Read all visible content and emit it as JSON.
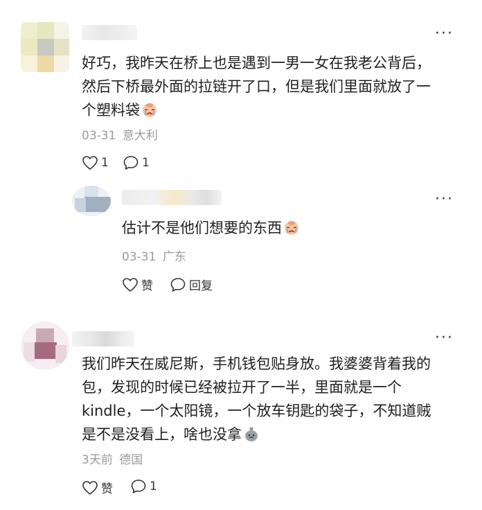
{
  "comments": [
    {
      "text_lines": [
        "好巧，我昨天在桥上也是遇到一男一女在我老公背后，",
        "然后下桥最外面的拉链开了口，但是我们里面就放了一",
        "个塑料袋"
      ],
      "emoji_icon": "crying-face-emoji",
      "date": "03-31",
      "location": "意大利",
      "like_count": "1",
      "reply_count": "1",
      "reply": {
        "text": "估计不是他们想要的东西",
        "emoji_icon": "crying-face-emoji",
        "date": "03-31",
        "location": "广东",
        "like_label": "赞",
        "reply_label": "回复"
      }
    },
    {
      "text_lines": [
        "我们昨天在威尼斯，手机钱包贴身放。我婆婆背着我的",
        "包，发现的时候已经被拉开了一半，里面就是一个",
        "kindle，一个太阳镜，一个放车钥匙的袋子，不知道贼",
        "是不是没看上，啥也没拿"
      ],
      "emoji_icon": "money-bag-emoji",
      "date": "3天前",
      "location": "德国",
      "like_label": "赞",
      "reply_count": "1"
    }
  ],
  "more_icon": "more-dots-icon"
}
